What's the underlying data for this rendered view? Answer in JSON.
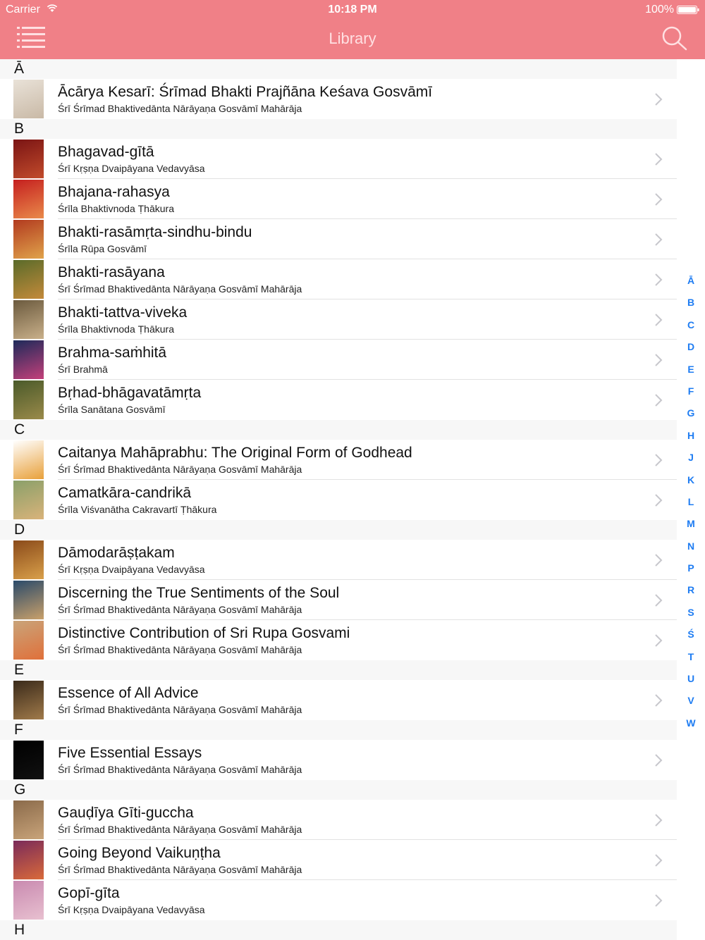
{
  "status": {
    "carrier": "Carrier",
    "time": "10:18 PM",
    "battery": "100%"
  },
  "nav": {
    "title": "Library",
    "menu_icon": "hamburger-menu-icon",
    "search_icon": "search-icon"
  },
  "sections": [
    {
      "letter": "Ā",
      "rows": [
        {
          "title": "Ācārya Kesarī: Śrīmad Bhakti Prajñāna Keśava Gosvāmī",
          "author": "Śrī Śrīmad Bhaktivedānta Nārāyaṇa Gosvāmī Mahārāja",
          "colors": [
            "#e9e2d8",
            "#c9b9a6"
          ]
        }
      ]
    },
    {
      "letter": "B",
      "rows": [
        {
          "title": "Bhagavad-gītā",
          "author": "Śrī Kṛṣṇa Dvaipāyana Vedavyāsa",
          "colors": [
            "#7a1414",
            "#c24b2b"
          ]
        },
        {
          "title": "Bhajana-rahasya",
          "author": "Śrīla Bhaktivnoda Ṭhākura",
          "colors": [
            "#c51f1f",
            "#e98a4a"
          ]
        },
        {
          "title": "Bhakti-rasāmṛta-sindhu-bindu",
          "author": "Śrīla Rūpa Gosvāmī",
          "colors": [
            "#b23a1f",
            "#e0a34b"
          ]
        },
        {
          "title": "Bhakti-rasāyana",
          "author": "Śrī Śrīmad Bhaktivedānta Nārāyaṇa Gosvāmī Mahārāja",
          "colors": [
            "#5a6b2a",
            "#c48a3a"
          ]
        },
        {
          "title": "Bhakti-tattva-viveka",
          "author": "Śrīla Bhaktivnoda Ṭhākura",
          "colors": [
            "#6b5a3e",
            "#c9b08a"
          ]
        },
        {
          "title": "Brahma-saṁhitā",
          "author": "Śrī Brahmā",
          "colors": [
            "#1d2a5a",
            "#c4407a"
          ]
        },
        {
          "title": "Bṛhad-bhāgavatāmṛta",
          "author": "Śrīla Sanātana Gosvāmī",
          "colors": [
            "#4a5a2a",
            "#9a8a4a"
          ]
        }
      ]
    },
    {
      "letter": "C",
      "rows": [
        {
          "title": "Caitanya Mahāprabhu: The Original Form of Godhead",
          "author": "Śrī Śrīmad Bhaktivedānta Nārāyaṇa Gosvāmī Mahārāja",
          "colors": [
            "#ffffff",
            "#e8a03a"
          ]
        },
        {
          "title": "Camatkāra-candrikā",
          "author": "Śrīla Viśvanātha Cakravartī Ṭhākura",
          "colors": [
            "#8aa06a",
            "#d9b37a"
          ]
        }
      ]
    },
    {
      "letter": "D",
      "rows": [
        {
          "title": "Dāmodarāṣṭakam",
          "author": "Śrī Kṛṣṇa Dvaipāyana Vedavyāsa",
          "colors": [
            "#8a4a1a",
            "#d9a04a"
          ]
        },
        {
          "title": "Discerning the True Sentiments of the Soul",
          "author": "Śrī Śrīmad Bhaktivedānta Nārāyaṇa Gosvāmī Mahārāja",
          "colors": [
            "#2a4a6a",
            "#c9a06a"
          ]
        },
        {
          "title": "Distinctive Contribution of Sri Rupa Gosvami",
          "author": "Śrī Śrīmad Bhaktivedānta Nārāyaṇa Gosvāmī Mahārāja",
          "colors": [
            "#c9a47a",
            "#e0703a"
          ]
        }
      ]
    },
    {
      "letter": "E",
      "rows": [
        {
          "title": "Essence of All Advice",
          "author": "Śrī Śrīmad Bhaktivedānta Nārāyaṇa Gosvāmī Mahārāja",
          "colors": [
            "#3a2a1a",
            "#a07a4a"
          ]
        }
      ]
    },
    {
      "letter": "F",
      "rows": [
        {
          "title": "Five Essential Essays",
          "author": "Śrī Śrīmad Bhaktivedānta Nārāyaṇa Gosvāmī Mahārāja",
          "colors": [
            "#000000",
            "#111111"
          ]
        }
      ]
    },
    {
      "letter": "G",
      "rows": [
        {
          "title": "Gauḍīya Gīti-guccha",
          "author": "Śrī Śrīmad Bhaktivedānta Nārāyaṇa Gosvāmī Mahārāja",
          "colors": [
            "#8a6a4a",
            "#c9a47a"
          ]
        },
        {
          "title": "Going Beyond Vaikuṇṭha",
          "author": "Śrī Śrīmad Bhaktivedānta Nārāyaṇa Gosvāmī Mahārāja",
          "colors": [
            "#7a2a5a",
            "#d96a3a"
          ]
        },
        {
          "title": "Gopī-gīta",
          "author": "Śrī Kṛṣṇa Dvaipāyana Vedavyāsa",
          "colors": [
            "#c98ab0",
            "#e8c0d0"
          ]
        }
      ]
    },
    {
      "letter": "H",
      "rows": []
    }
  ],
  "index": [
    "Ā",
    "B",
    "C",
    "D",
    "E",
    "F",
    "G",
    "H",
    "J",
    "K",
    "L",
    "M",
    "N",
    "P",
    "R",
    "S",
    "Ś",
    "T",
    "U",
    "V",
    "W"
  ]
}
